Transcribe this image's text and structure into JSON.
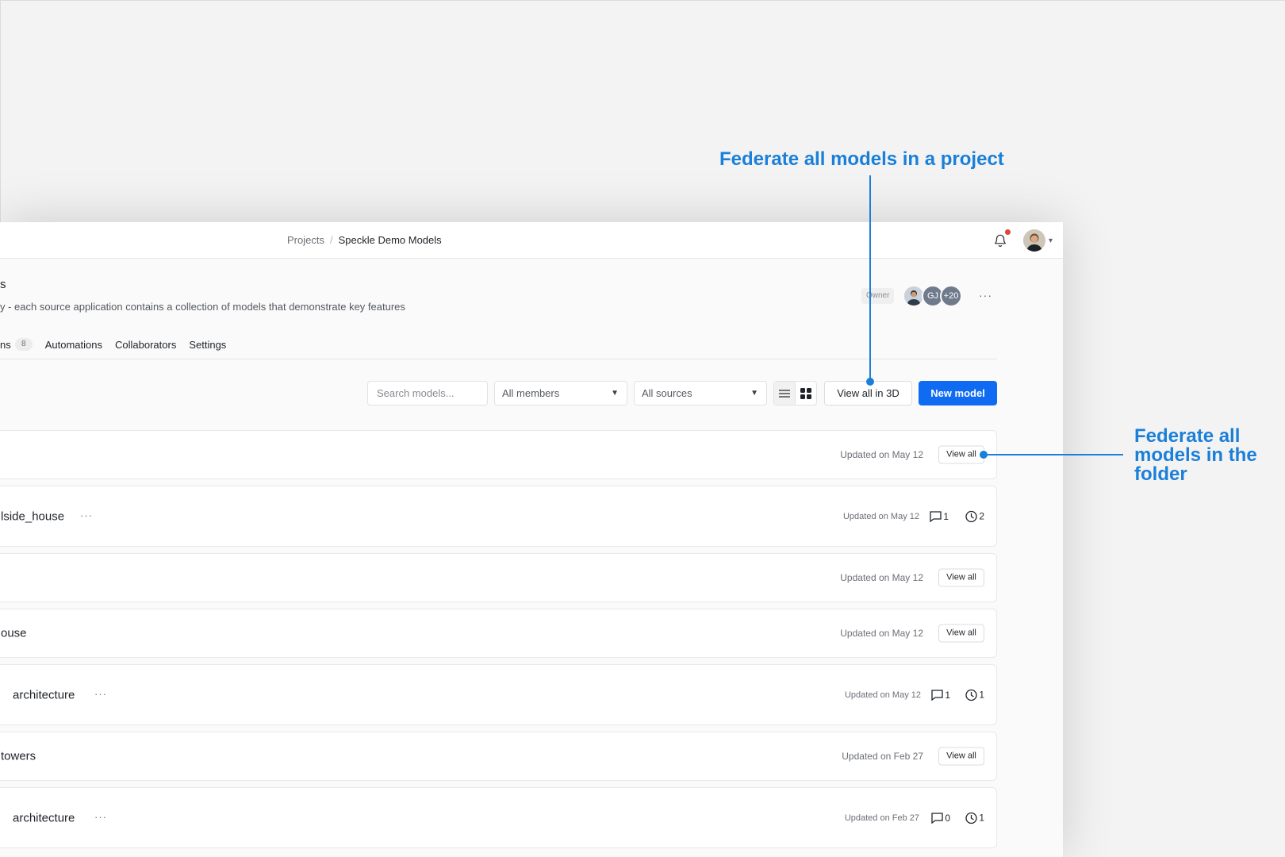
{
  "breadcrumb": {
    "root": "Projects",
    "separator": "/",
    "current": "Speckle Demo Models"
  },
  "header": {
    "title": "s",
    "description": "y - each source application contains a collection of models that demonstrate key features",
    "role": "Owner",
    "team": {
      "initials": "GJ",
      "more": "+20"
    },
    "more_label": "···"
  },
  "tabs": [
    {
      "label": "ns",
      "count": "8"
    },
    {
      "label": "Automations"
    },
    {
      "label": "Collaborators"
    },
    {
      "label": "Settings"
    }
  ],
  "toolbar": {
    "search_placeholder": "Search models...",
    "members_filter": "All members",
    "sources_filter": "All sources",
    "view_all_3d": "View all in 3D",
    "new_model": "New model"
  },
  "rows": [
    {
      "name": "",
      "updated": "Updated on May 12",
      "action": "View all"
    },
    {
      "name": "lside_house",
      "more": "···",
      "updated": "Updated on May 12",
      "comments": "1",
      "versions": "2"
    },
    {
      "name": "",
      "updated": "Updated on May 12",
      "action": "View all"
    },
    {
      "name": "ouse",
      "updated": "Updated on May 12",
      "action": "View all"
    },
    {
      "name": "architecture",
      "more": "···",
      "updated": "Updated on May 12",
      "comments": "1",
      "versions": "1"
    },
    {
      "name": "towers",
      "updated": "Updated on Feb 27",
      "action": "View all"
    },
    {
      "name": "architecture",
      "more": "···",
      "updated": "Updated on Feb 27",
      "comments": "0",
      "versions": "1"
    }
  ],
  "annotations": {
    "project": "Federate all models in a project",
    "folder": "Federate all models in the folder"
  },
  "colors": {
    "accent": "#1a7fd9",
    "primary_button": "#0f6cf2",
    "notification": "#e0443e"
  },
  "icons": [
    "bell-icon",
    "chevron-down-icon",
    "list-view-icon",
    "grid-view-icon",
    "comment-icon",
    "history-icon"
  ]
}
